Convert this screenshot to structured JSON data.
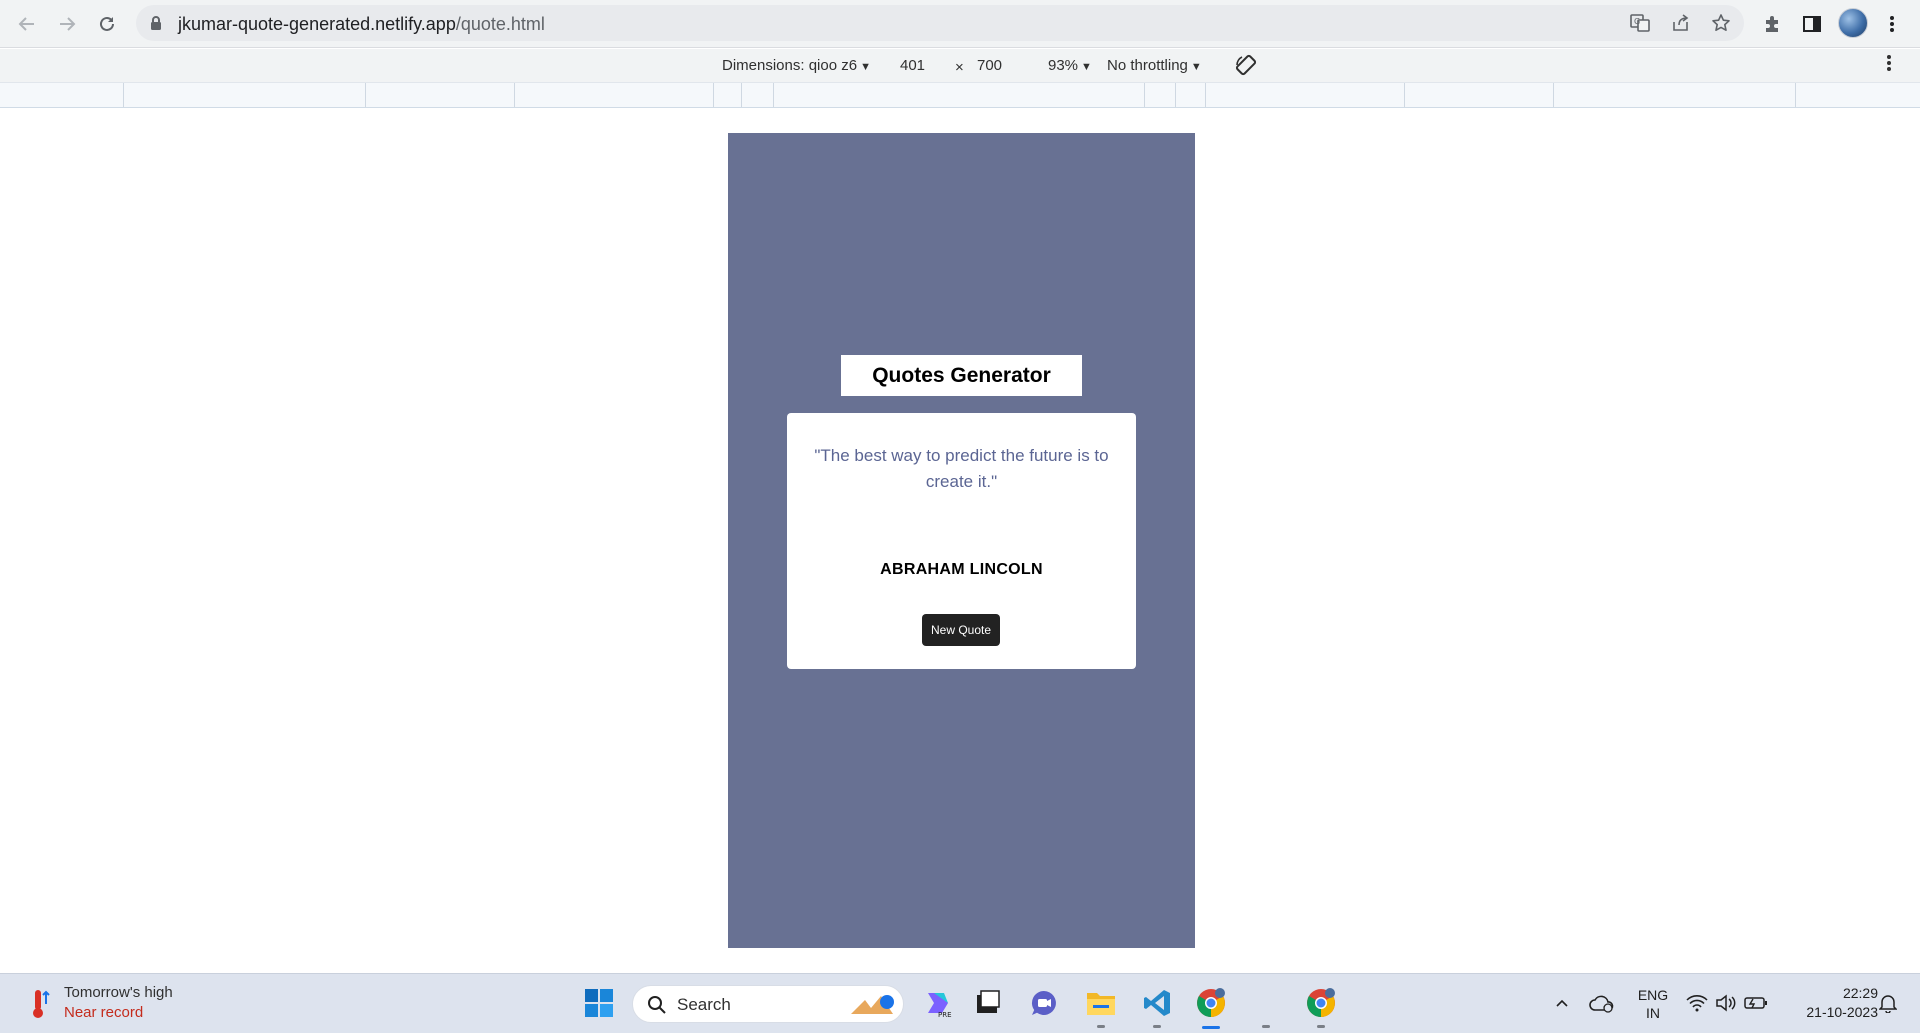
{
  "browser": {
    "url_host": "jkumar-quote-generated.netlify.app",
    "url_path": "/quote.html"
  },
  "devtools": {
    "dimensions_label": "Dimensions: qioo z6",
    "width": "401",
    "times": "×",
    "height": "700",
    "zoom": "93%",
    "throttling": "No throttling"
  },
  "app": {
    "title": "Quotes Generator",
    "quote": "\"The best way to predict the future is to create it.\"",
    "author": "ABRAHAM LINCOLN",
    "new_quote_label": "New Quote",
    "background_color": "#687193"
  },
  "taskbar": {
    "weather_title": "Tomorrow's high",
    "weather_subtitle": "Near record",
    "search_label": "Search",
    "language_line1": "ENG",
    "language_line2": "IN",
    "time": "22:29",
    "date": "21-10-2023"
  }
}
